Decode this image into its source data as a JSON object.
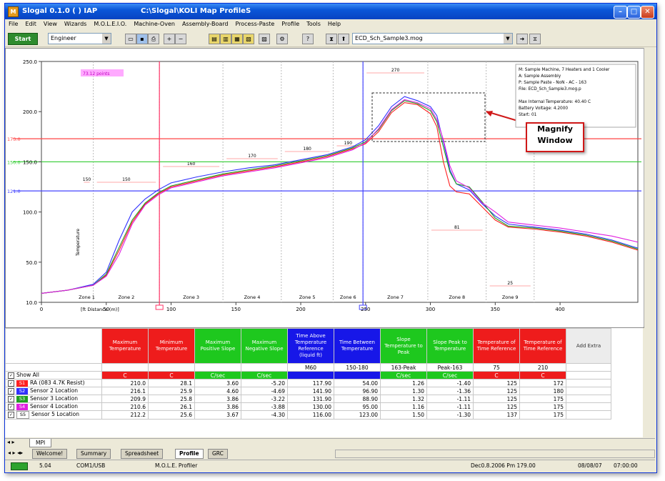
{
  "window": {
    "app_title": "Slogal 0.1.0 ( ) IAP",
    "file_title": "C:\\Slogal\\KOLI Map ProfileS"
  },
  "menu": [
    "File",
    "Edit",
    "View",
    "Wizards",
    "M.O.L.E.I.O.",
    "Machine-Oven",
    "Assembly-Board",
    "Process-Paste",
    "Profile",
    "Tools",
    "Help"
  ],
  "toolbar": {
    "start_label": "Start",
    "user_value": "Engineer",
    "file_value": "ECD_Sch_Sample3.mog"
  },
  "chart_data": {
    "type": "line",
    "title": "",
    "xlabel": "[ft Distance (m)]",
    "ylabel": "Temperature",
    "xlim": [
      0,
      460
    ],
    "ylim": [
      10,
      250
    ],
    "x_ticks": [
      "0",
      "50",
      "100",
      "150",
      "200",
      "250",
      "300",
      "350",
      "400"
    ],
    "y_ticks": [
      "10.0",
      "50.0",
      "100.0",
      "150.0",
      "200.0",
      "250.0"
    ],
    "hlines": [
      {
        "y": 173.0,
        "color": "#ff4444",
        "label": "173.0"
      },
      {
        "y": 150.0,
        "color": "#33cc33",
        "label": "150.0"
      },
      {
        "y": 121.0,
        "color": "#4444ff",
        "label": "121.0"
      }
    ],
    "vlines": [
      {
        "x": 91,
        "color": "#ff3366"
      },
      {
        "x": 248,
        "color": "#4444ff"
      }
    ],
    "zones": [
      "Zone 1",
      "Zone 2",
      "Zone 3",
      "Zone 4",
      "Zone 5",
      "Zone 6",
      "Zone 7",
      "Zone 8",
      "Zone 9"
    ],
    "zone_setpoints": [
      "150",
      "150",
      "160",
      "170",
      "180",
      "190",
      "270",
      "81",
      "25"
    ],
    "annotation_time": "73.12 points",
    "info_box": [
      "M: Sample Machine, 7 Heaters and 1 Cooler",
      "A: Sample Assembly",
      "P: Sample Paste - NoN - AC - 163",
      "File: ECD_Sch_Sample3.mog.p",
      "",
      "Max Internal Temperature: 40.40 C",
      "Battery Voltage: 4.2000",
      "Start: 01"
    ],
    "series": [
      {
        "name": "RA (083 4.7K Resist)",
        "color": "#ff2020",
        "x": [
          0,
          20,
          40,
          50,
          60,
          70,
          80,
          90,
          100,
          120,
          140,
          160,
          180,
          200,
          220,
          240,
          250,
          260,
          270,
          280,
          290,
          300,
          305,
          310,
          315,
          320,
          330,
          340,
          350,
          360,
          380,
          400,
          420,
          440,
          460
        ],
        "y": [
          19,
          22,
          27,
          37,
          62,
          90,
          108,
          118,
          125,
          131,
          137,
          141,
          145,
          150,
          155,
          163,
          168,
          180,
          199,
          209,
          207,
          198,
          185,
          150,
          126,
          120,
          118,
          105,
          92,
          85,
          83,
          80,
          76,
          70,
          62
        ]
      },
      {
        "name": "Sensor 2 Location",
        "color": "#3030ff",
        "x": [
          0,
          20,
          40,
          50,
          60,
          70,
          80,
          90,
          100,
          120,
          140,
          160,
          180,
          200,
          220,
          240,
          250,
          260,
          270,
          280,
          290,
          300,
          305,
          310,
          315,
          320,
          330,
          340,
          350,
          360,
          380,
          400,
          420,
          440,
          460
        ],
        "y": [
          19,
          22,
          28,
          40,
          72,
          100,
          113,
          122,
          129,
          135,
          140,
          144,
          147,
          152,
          157,
          165,
          172,
          186,
          205,
          215,
          211,
          205,
          196,
          170,
          142,
          128,
          122,
          108,
          96,
          88,
          85,
          82,
          78,
          72,
          64
        ]
      },
      {
        "name": "Sensor 3 Location",
        "color": "#20a020",
        "x": [
          0,
          20,
          40,
          50,
          60,
          70,
          80,
          90,
          100,
          120,
          140,
          160,
          180,
          200,
          220,
          240,
          250,
          260,
          270,
          280,
          290,
          300,
          305,
          310,
          315,
          320,
          330,
          340,
          350,
          360,
          380,
          400,
          420,
          440,
          460
        ],
        "y": [
          19,
          22,
          27,
          38,
          65,
          92,
          109,
          119,
          126,
          132,
          138,
          142,
          146,
          151,
          156,
          164,
          170,
          182,
          201,
          211,
          208,
          201,
          190,
          165,
          140,
          128,
          125,
          110,
          94,
          86,
          84,
          81,
          77,
          71,
          63
        ]
      },
      {
        "name": "Sensor 4 Location",
        "color": "#e020e0",
        "x": [
          0,
          20,
          40,
          50,
          60,
          70,
          80,
          90,
          100,
          120,
          140,
          160,
          180,
          200,
          220,
          240,
          250,
          260,
          270,
          280,
          290,
          300,
          305,
          310,
          315,
          320,
          330,
          340,
          350,
          360,
          380,
          400,
          420,
          440,
          460
        ],
        "y": [
          19,
          22,
          27,
          36,
          58,
          88,
          107,
          117,
          124,
          130,
          136,
          140,
          144,
          149,
          154,
          162,
          169,
          183,
          202,
          212,
          209,
          203,
          192,
          172,
          146,
          131,
          124,
          109,
          100,
          90,
          87,
          84,
          80,
          76,
          70
        ]
      }
    ]
  },
  "callout": "Magnify Window",
  "grid": {
    "show_all_label": "Show All",
    "add_extra": "Add Extra",
    "headers": [
      {
        "label": "Maximum Temperature",
        "color": "red"
      },
      {
        "label": "Minimum Temperature",
        "color": "red"
      },
      {
        "label": "Maximum Positive Slope",
        "color": "green"
      },
      {
        "label": "Maximum Negative Slope",
        "color": "green"
      },
      {
        "label": "Time Above Temperature Reference (liquid ft)",
        "color": "blue"
      },
      {
        "label": "Time Between Temperature",
        "color": "blue"
      },
      {
        "label": "Slope Temperature to Peak",
        "color": "green"
      },
      {
        "label": "Slope Peak to Temperature",
        "color": "green"
      },
      {
        "label": "Temperature of Time Reference",
        "color": "red"
      },
      {
        "label": "Temperature of Time Reference",
        "color": "red"
      }
    ],
    "param_row": [
      "",
      "",
      "",
      "",
      "M60",
      "150-180",
      "163-Peak",
      "Peak-163",
      "75",
      "210"
    ],
    "units_row": [
      "C",
      "C",
      "C/sec",
      "C/sec",
      "",
      "",
      "C/sec",
      "C/sec",
      "C",
      "C"
    ],
    "rows": [
      {
        "badge": "S1",
        "badge_color": "#ff2020",
        "name": "RA (083 4.7K Resist)",
        "values": [
          "210.0",
          "28.1",
          "3.60",
          "-5.20",
          "117.90",
          "54.00",
          "1.26",
          "-1.40",
          "125",
          "172"
        ]
      },
      {
        "badge": "S2",
        "badge_color": "#3030ff",
        "name": "Sensor 2 Location",
        "values": [
          "216.1",
          "25.9",
          "4.60",
          "-4.69",
          "141.90",
          "96.90",
          "1.30",
          "-1.36",
          "125",
          "180"
        ]
      },
      {
        "badge": "S3",
        "badge_color": "#20a020",
        "name": "Sensor 3 Location",
        "values": [
          "209.9",
          "25.8",
          "3.86",
          "-3.22",
          "131.90",
          "88.90",
          "1.32",
          "-1.11",
          "125",
          "175"
        ]
      },
      {
        "badge": "S4",
        "badge_color": "#e020e0",
        "name": "Sensor 4 Location",
        "values": [
          "210.6",
          "26.1",
          "3.86",
          "-3.88",
          "130.00",
          "95.00",
          "1.16",
          "-1.11",
          "125",
          "175"
        ]
      },
      {
        "badge": "S5",
        "badge_color": "#ffffff",
        "name": "Sensor 5 Location",
        "values": [
          "212.2",
          "25.6",
          "3.67",
          "-4.30",
          "116.00",
          "123.00",
          "1.50",
          "-1.30",
          "137",
          "175"
        ]
      }
    ]
  },
  "sheet_tab": "MPI",
  "view_tabs": [
    "Welcome!",
    "Summary",
    "Spreadsheet",
    "Profile",
    "GRC"
  ],
  "status": {
    "led_label": "5.04",
    "port": "COM1/USB",
    "mode": "M.O.L.E. Profiler",
    "datetime": "Dec0.8.2006 Pm 179.00",
    "date2": "08/08/07",
    "time": "07:00:00"
  }
}
